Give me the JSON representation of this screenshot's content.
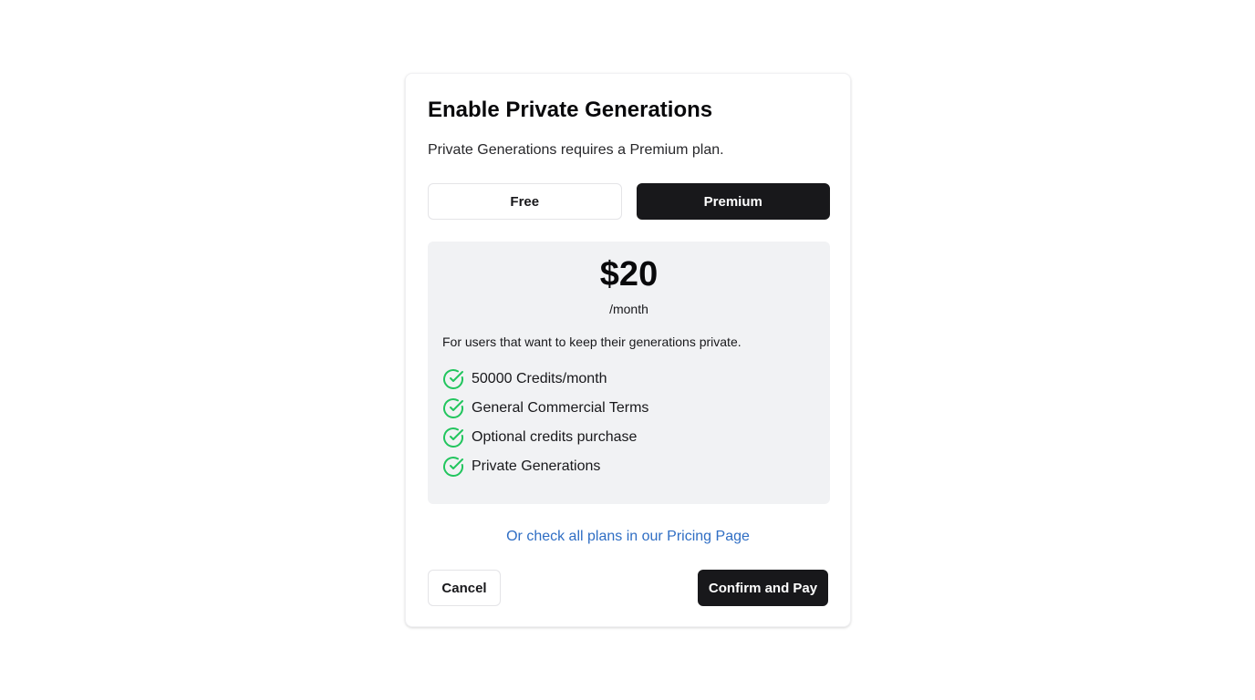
{
  "dialog": {
    "title": "Enable Private Generations",
    "subtitle": "Private Generations requires a Premium plan.",
    "plans": [
      {
        "label": "Free",
        "selected": false
      },
      {
        "label": "Premium",
        "selected": true
      }
    ],
    "selected_plan": {
      "price": "$20",
      "period": "/month",
      "description": "For users that want to keep their generations private.",
      "features": [
        {
          "label": "50000 Credits/month",
          "icon": "check-circle-icon"
        },
        {
          "label": "General Commercial Terms",
          "icon": "check-circle-icon"
        },
        {
          "label": "Optional credits purchase",
          "icon": "check-circle-icon"
        },
        {
          "label": "Private Generations",
          "icon": "check-circle-icon"
        }
      ]
    },
    "pricing_link": "Or check all plans in our Pricing Page",
    "cancel_label": "Cancel",
    "confirm_label": "Confirm and Pay"
  },
  "colors": {
    "accent_dark": "#18181b",
    "check_green": "#22c55e",
    "link_blue": "#2f6ec4",
    "card_bg": "#f1f2f4"
  }
}
